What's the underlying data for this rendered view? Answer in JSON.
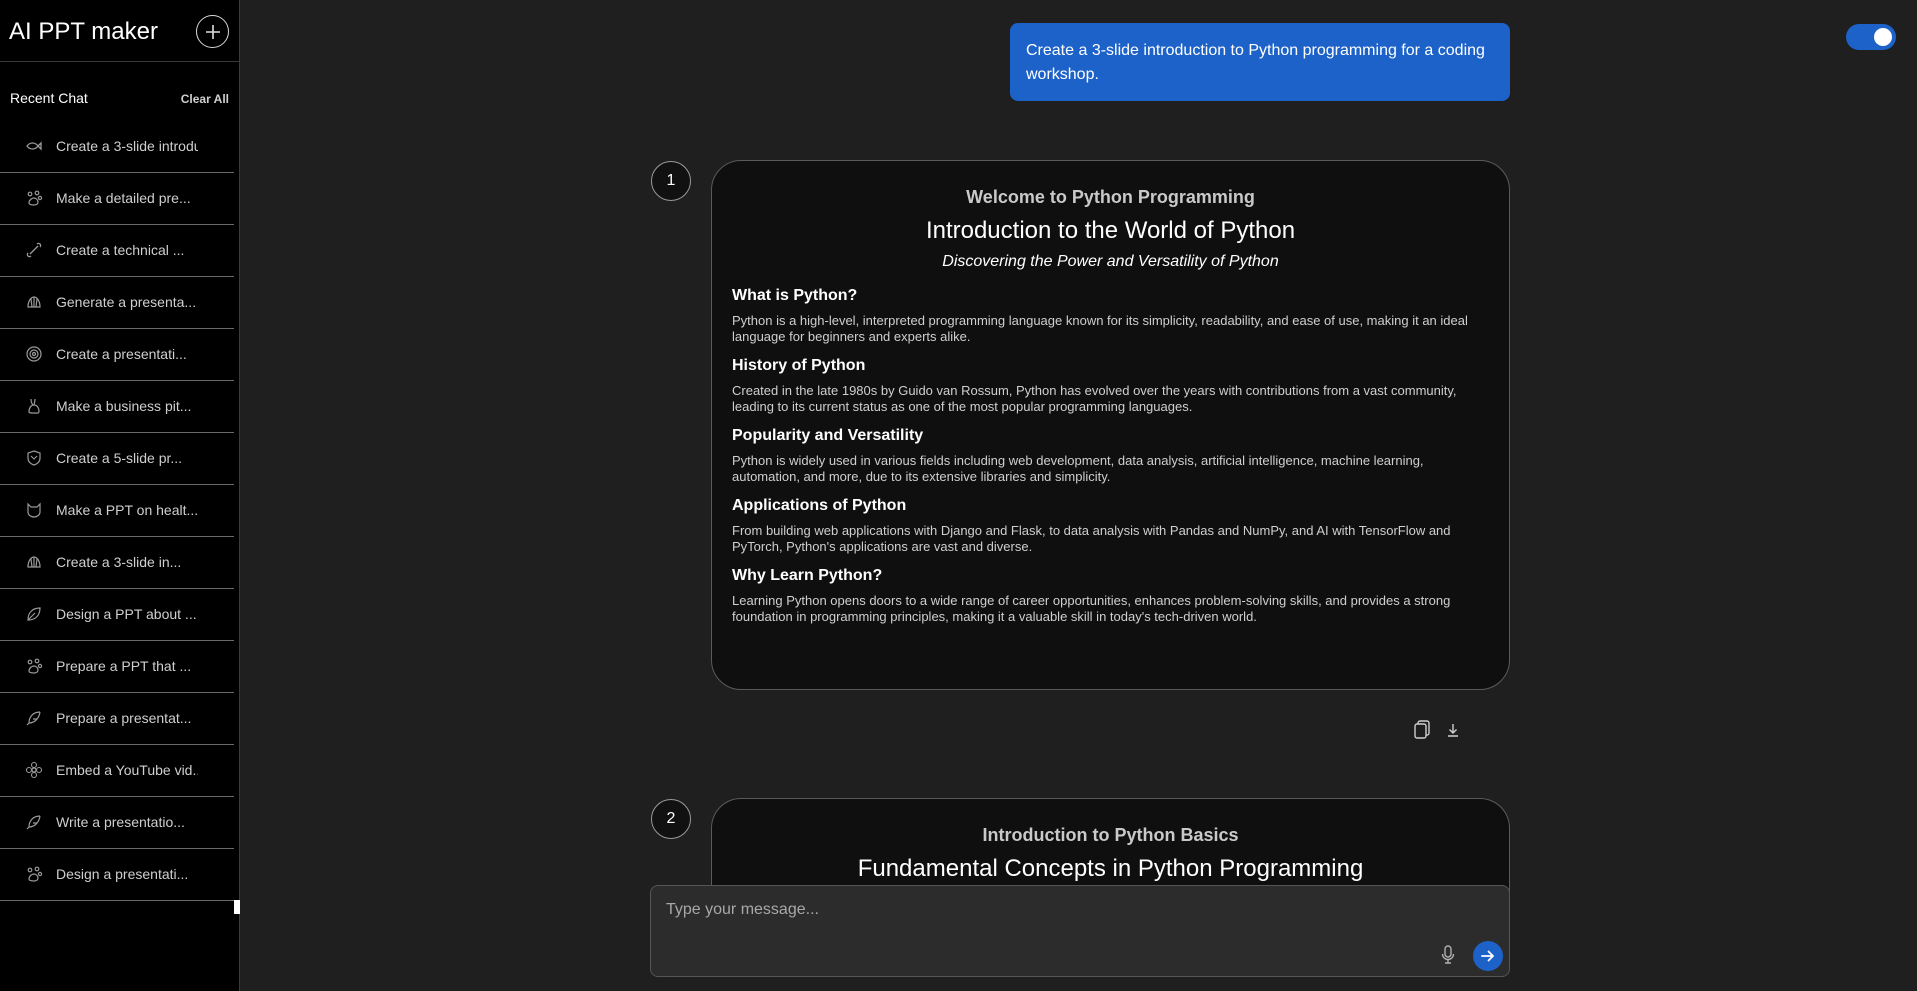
{
  "app": {
    "title": "AI PPT maker"
  },
  "sidebar": {
    "recent_label": "Recent Chat",
    "clear_label": "Clear All",
    "items": [
      {
        "label": "Create a 3-slide introdu",
        "icon": "fish-icon"
      },
      {
        "label": "Make a detailed pre...",
        "icon": "paw-icon"
      },
      {
        "label": "Create a technical ...",
        "icon": "bone-icon"
      },
      {
        "label": "Generate a presenta...",
        "icon": "shell-icon"
      },
      {
        "label": "Create a presentati...",
        "icon": "spiral-icon"
      },
      {
        "label": "Make a business pit...",
        "icon": "rabbit-icon"
      },
      {
        "label": "Create a 5-slide pr...",
        "icon": "shield-icon"
      },
      {
        "label": "Make a PPT on healt...",
        "icon": "cat-icon"
      },
      {
        "label": "Create a 3-slide in...",
        "icon": "shell-icon"
      },
      {
        "label": "Design a PPT about ...",
        "icon": "leaf-icon"
      },
      {
        "label": "Prepare a PPT that ...",
        "icon": "paw-icon"
      },
      {
        "label": "Prepare a presentat...",
        "icon": "feather-icon"
      },
      {
        "label": "Embed a YouTube vid...",
        "icon": "flower-icon"
      },
      {
        "label": "Write a presentatio...",
        "icon": "feather-icon"
      },
      {
        "label": "Design a presentati...",
        "icon": "paw-icon"
      }
    ]
  },
  "chat": {
    "user_message": "Create a 3-slide introduction to Python programming for a coding workshop."
  },
  "slides": [
    {
      "number": "1",
      "heading": "Welcome to Python Programming",
      "title": "Introduction to the World of Python",
      "subtitle": "Discovering the Power and Versatility of Python",
      "sections": [
        {
          "heading": "What is Python?",
          "text": "Python is a high-level, interpreted programming language known for its simplicity, readability, and ease of use, making it an ideal language for beginners and experts alike."
        },
        {
          "heading": "History of Python",
          "text": "Created in the late 1980s by Guido van Rossum, Python has evolved over the years with contributions from a vast community, leading to its current status as one of the most popular programming languages."
        },
        {
          "heading": "Popularity and Versatility",
          "text": "Python is widely used in various fields including web development, data analysis, artificial intelligence, machine learning, automation, and more, due to its extensive libraries and simplicity."
        },
        {
          "heading": "Applications of Python",
          "text": "From building web applications with Django and Flask, to data analysis with Pandas and NumPy, and AI with TensorFlow and PyTorch, Python's applications are vast and diverse."
        },
        {
          "heading": "Why Learn Python?",
          "text": "Learning Python opens doors to a wide range of career opportunities, enhances problem-solving skills, and provides a strong foundation in programming principles, making it a valuable skill in today's tech-driven world."
        }
      ]
    },
    {
      "number": "2",
      "heading": "Introduction to Python Basics",
      "title": "Fundamental Concepts in Python Programming"
    }
  ],
  "composer": {
    "placeholder": "Type your message..."
  },
  "colors": {
    "accent": "#1d62c8",
    "background": "#1f1f1f",
    "sidebar": "#000000",
    "slide": "#0f0f0f"
  }
}
